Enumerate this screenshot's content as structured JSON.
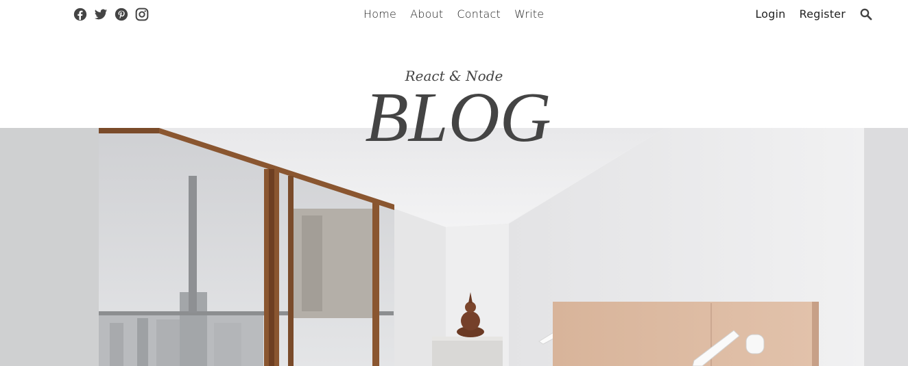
{
  "social": {
    "icons": [
      "facebook-icon",
      "twitter-icon",
      "pinterest-icon",
      "instagram-icon"
    ]
  },
  "nav": {
    "items": [
      "Home",
      "About",
      "Contact",
      "Write"
    ]
  },
  "auth": {
    "login": "Login",
    "register": "Register"
  },
  "search": {
    "icon": "search-icon"
  },
  "header": {
    "subtitle": "React & Node",
    "title": "BLOG"
  },
  "colors": {
    "text": "#222222",
    "title": "#444444",
    "icon": "#444444"
  }
}
